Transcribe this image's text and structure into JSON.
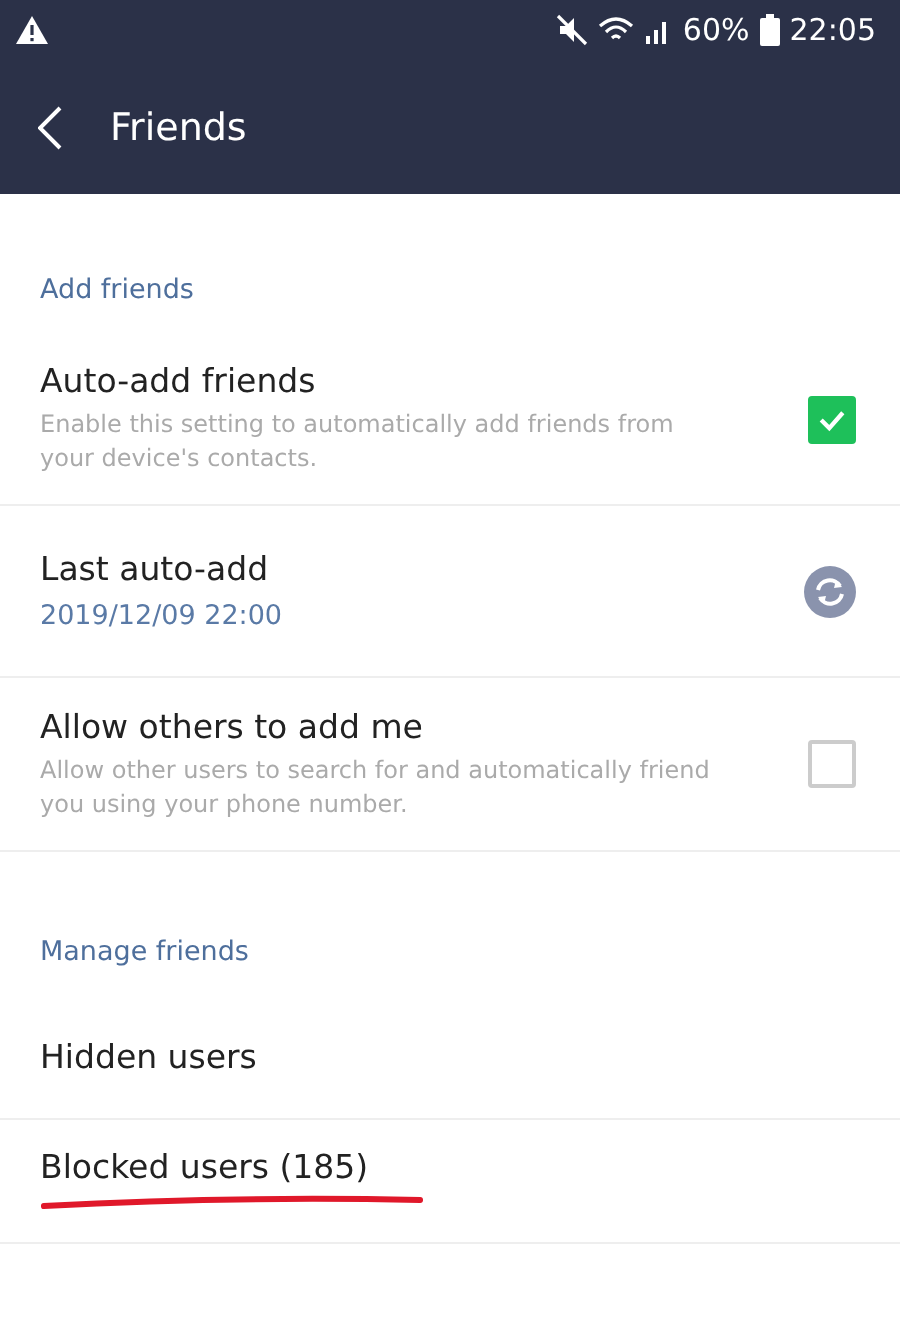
{
  "status_bar": {
    "battery": "60%",
    "time": "22:05"
  },
  "header": {
    "title": "Friends"
  },
  "sections": [
    {
      "title": "Add friends",
      "items": [
        {
          "kind": "checkbox",
          "label": "Auto-add friends",
          "description": "Enable this setting to automatically add friends from your device's contacts.",
          "checked": true
        },
        {
          "kind": "refresh",
          "label": "Last auto-add",
          "value": "2019/12/09 22:00"
        },
        {
          "kind": "checkbox",
          "label": "Allow others to add me",
          "description": "Allow other users to search for and automatically friend you using your phone number.",
          "checked": false
        }
      ]
    },
    {
      "title": "Manage friends",
      "items": [
        {
          "kind": "link",
          "label": "Hidden users",
          "underlined": false
        },
        {
          "kind": "link",
          "label": "Blocked users (185)",
          "underlined": true
        }
      ]
    }
  ]
}
